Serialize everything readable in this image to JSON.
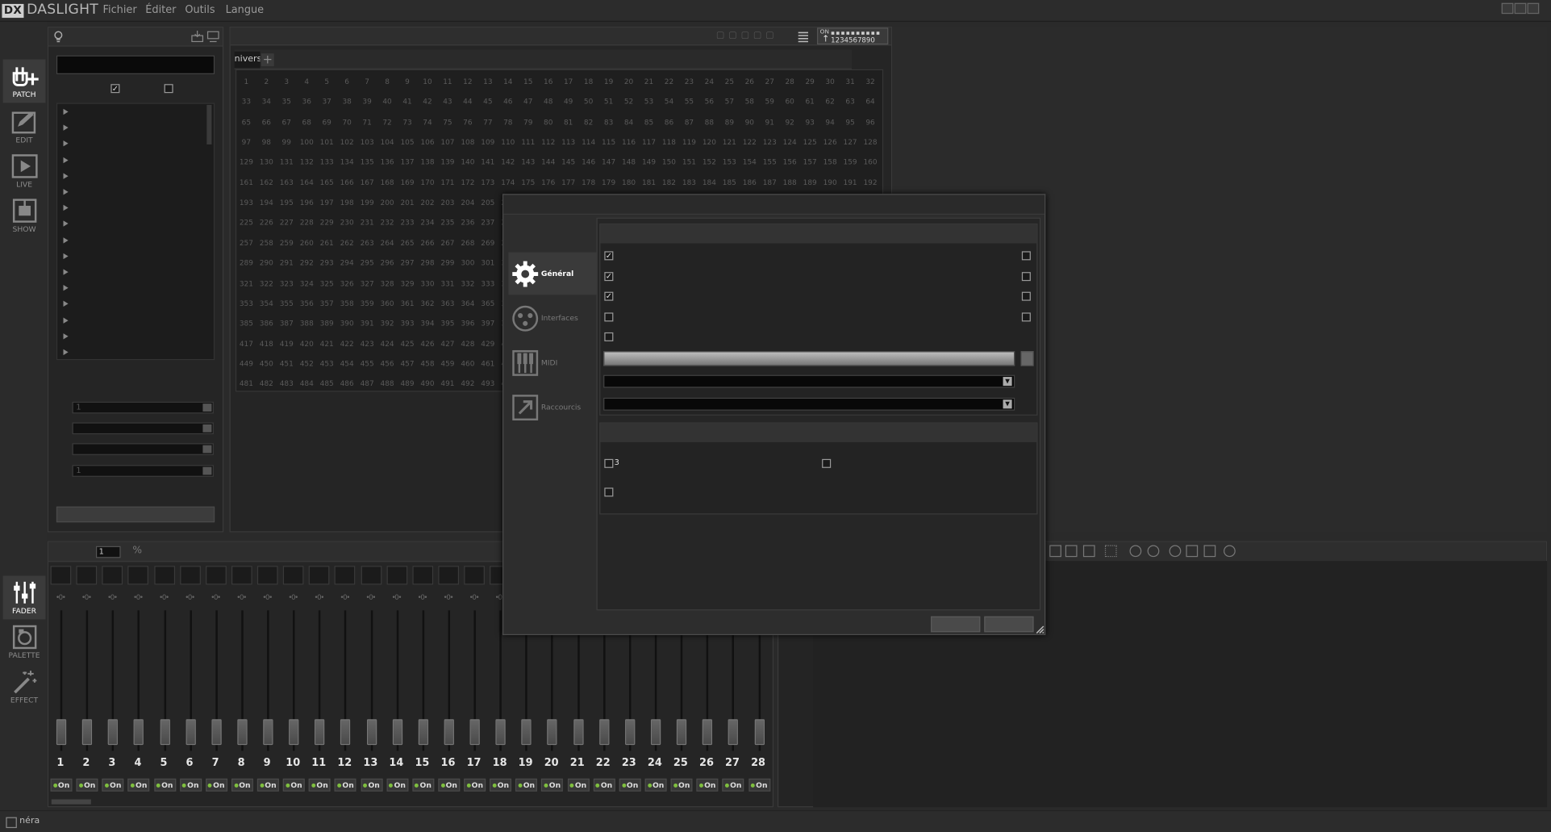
{
  "app": {
    "logo_mark": "DX",
    "title": "DASLIGHT"
  },
  "menu": [
    "Fichier",
    "Éditer",
    "Outils",
    "Langue"
  ],
  "nav_top": [
    {
      "label": "PATCH",
      "icon": "patch-plug-icon",
      "active": true
    },
    {
      "label": "EDIT",
      "icon": "edit-pencil-icon",
      "active": false
    },
    {
      "label": "LIVE",
      "icon": "live-play-icon",
      "active": false
    },
    {
      "label": "SHOW",
      "icon": "show-stage-icon",
      "active": false
    }
  ],
  "nav_bottom": [
    {
      "label": "FADER",
      "icon": "fader-sliders-icon",
      "active": true
    },
    {
      "label": "PALETTE",
      "icon": "palette-icon",
      "active": false
    },
    {
      "label": "EFFECT",
      "icon": "effect-wand-icon",
      "active": false
    }
  ],
  "library": {
    "search_value": "",
    "filter_a_checked": true,
    "filter_b_checked": false,
    "tree_rows": 16,
    "spin1_value": "1",
    "spin4_value": "1"
  },
  "universe": {
    "tab_label": "nivers",
    "add_tab": "+",
    "on_label": "ON",
    "on_digits": "1234567890",
    "cols": 32,
    "rows": 16
  },
  "fader_panel": {
    "page_value": "1",
    "percent_icon": "%",
    "count": 28,
    "value_label": "0",
    "on_label": "On"
  },
  "dialog": {
    "tabs": [
      {
        "label": "Général",
        "icon": "gear-icon",
        "active": true
      },
      {
        "label": "Interfaces",
        "icon": "dmx-connector-icon",
        "active": false
      },
      {
        "label": "MIDI",
        "icon": "midi-keyboard-icon",
        "active": false
      },
      {
        "label": "Raccourcis",
        "icon": "shortcut-arrow-icon",
        "active": false
      }
    ],
    "section1_checks_left": [
      true,
      true,
      true,
      false,
      false
    ],
    "section1_checks_right": [
      false,
      false,
      false,
      false
    ],
    "section2_check1_suffix": "3"
  },
  "status": {
    "text": "Généra"
  }
}
